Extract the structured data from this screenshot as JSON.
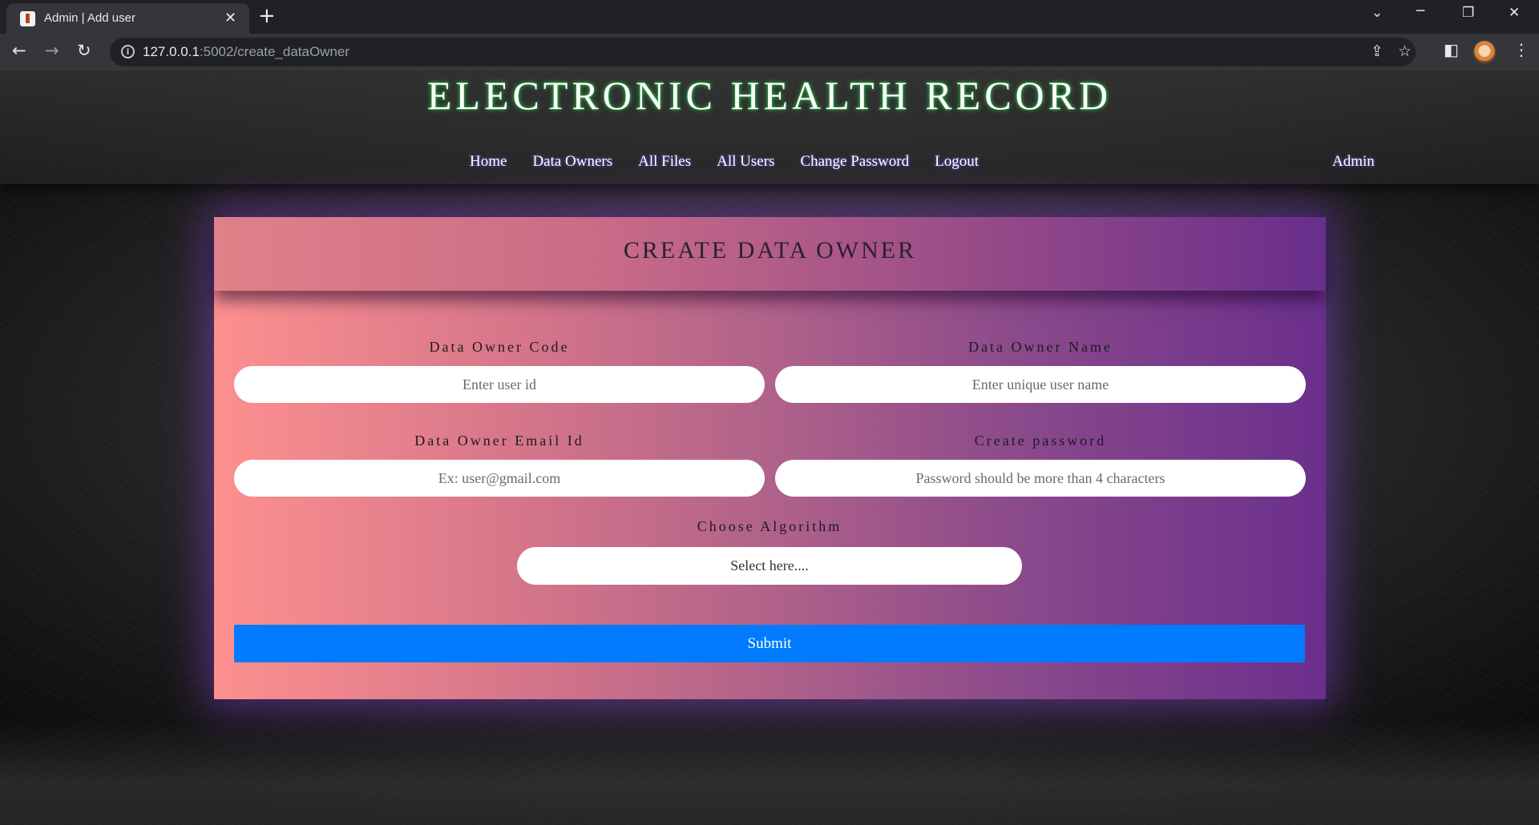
{
  "browser": {
    "tab_title": "Admin | Add user",
    "url_host": "127.0.0.1",
    "url_rest": ":5002/create_dataOwner"
  },
  "site": {
    "title": "ELECTRONIC HEALTH RECORD",
    "nav": [
      "Home",
      "Data Owners",
      "All Files",
      "All Users",
      "Change Password",
      "Logout"
    ],
    "user_link": "Admin"
  },
  "form": {
    "heading": "CREATE DATA OWNER",
    "code_label": "Data Owner Code",
    "code_placeholder": "Enter user id",
    "name_label": "Data Owner Name",
    "name_placeholder": "Enter unique user name",
    "email_label": "Data Owner Email Id",
    "email_placeholder": "Ex: user@gmail.com",
    "password_label": "Create password",
    "password_placeholder": "Password should be more than 4 characters",
    "algorithm_label": "Choose Algorithm",
    "algorithm_selected": "Select here....",
    "submit_label": "Submit"
  },
  "colors": {
    "submit": "#007bff",
    "card_left": "#fd908f",
    "card_right": "#6a2f8c",
    "title_glow": "#2bd64b"
  },
  "icons": {
    "back": "back-arrow-icon",
    "forward": "forward-arrow-icon",
    "reload": "reload-icon",
    "share": "share-icon",
    "bookmark": "star-icon",
    "sidepanel": "side-panel-icon",
    "menu": "kebab-menu-icon"
  }
}
